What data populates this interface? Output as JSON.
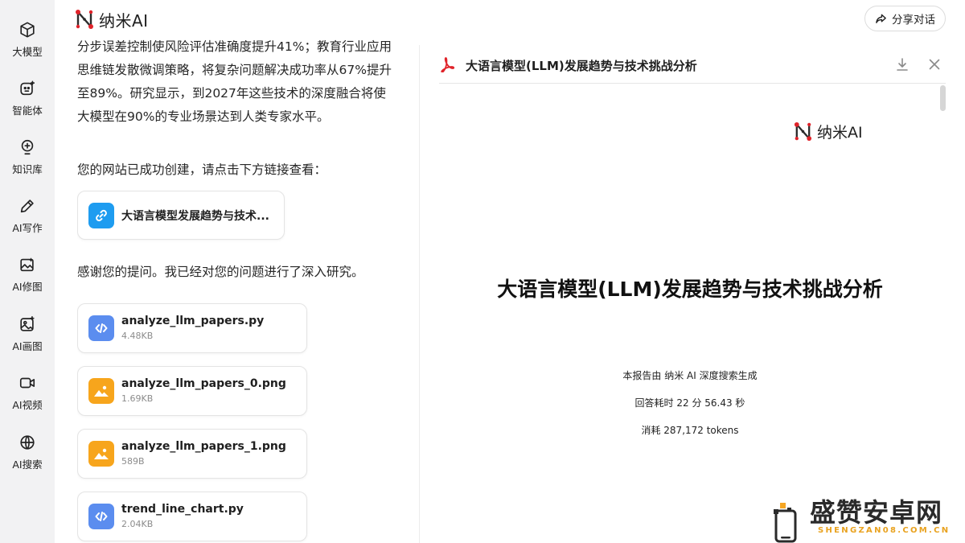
{
  "brand": {
    "name": "纳米AI"
  },
  "header": {
    "share_label": "分享对话"
  },
  "rail": {
    "items": [
      {
        "label": "大模型",
        "icon": "cube-icon"
      },
      {
        "label": "智能体",
        "icon": "agent-icon"
      },
      {
        "label": "知识库",
        "icon": "lightbulb-icon"
      },
      {
        "label": "AI写作",
        "icon": "pen-icon"
      },
      {
        "label": "AI修图",
        "icon": "image-edit-icon"
      },
      {
        "label": "AI画图",
        "icon": "palette-icon"
      },
      {
        "label": "AI视频",
        "icon": "video-icon"
      },
      {
        "label": "AI搜索",
        "icon": "globe-icon"
      }
    ]
  },
  "chat": {
    "paragraph_1": "分步误差控制使风险评估准确度提升41%；教育行业应用思维链发散微调策略，将复杂问题解决成功率从67%提升至89%。研究显示，到2027年这些技术的深度融合将使大模型在90%的专业场景达到人类专家水平。",
    "paragraph_2": "您的网站已成功创建，请点击下方链接查看：",
    "link_card_title": "大语言模型发展趋势与技术...",
    "paragraph_3": "感谢您的提问。我已经对您的问题进行了深入研究。",
    "files": [
      {
        "name": "analyze_llm_papers.py",
        "size": "4.48KB",
        "kind": "code"
      },
      {
        "name": "analyze_llm_papers_0.png",
        "size": "1.69KB",
        "kind": "image"
      },
      {
        "name": "analyze_llm_papers_1.png",
        "size": "589B",
        "kind": "image"
      },
      {
        "name": "trend_line_chart.py",
        "size": "2.04KB",
        "kind": "code"
      }
    ]
  },
  "preview": {
    "header_title": "大语言模型(LLM)发展趋势与技术挑战分析",
    "doc_logo_text": "纳米AI",
    "doc_title": "大语言模型(LLM)发展趋势与技术挑战分析",
    "generated_by": "本报告由 纳米 AI 深度搜索生成",
    "answer_time": "回答耗时 22 分 56.43 秒",
    "tokens": "消耗 287,172 tokens"
  },
  "watermark": {
    "text": "盛赞安卓网",
    "sub": "SHENGZAN08.COM.CN"
  },
  "colors": {
    "brand_red": "#e0232a",
    "link_icon_bg": "#1e9cf0",
    "code_icon_bg": "#5b8def",
    "image_icon_bg": "#f7a51c",
    "rail_bg": "#f2f2f3"
  }
}
